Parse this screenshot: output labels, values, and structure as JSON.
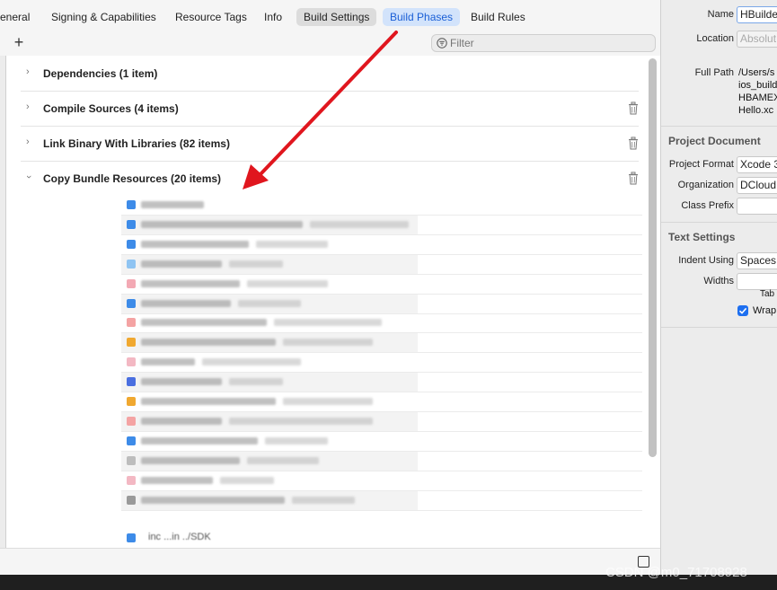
{
  "tabs": [
    {
      "label": "eneral"
    },
    {
      "label": "Signing & Capabilities"
    },
    {
      "label": "Resource Tags"
    },
    {
      "label": "Info"
    },
    {
      "label": "Build Settings"
    },
    {
      "label": "Build Phases"
    },
    {
      "label": "Build Rules"
    }
  ],
  "toolbar": {
    "add_label": "+",
    "filter_placeholder": "Filter"
  },
  "phases": [
    {
      "title": "Dependencies (1 item)"
    },
    {
      "title": "Compile Sources (4 items)"
    },
    {
      "title": "Link Binary With Libraries (82 items)"
    },
    {
      "title": "Copy Bundle Resources (20 items)"
    }
  ],
  "resources": {
    "last_row_text": "inc ...in ../SDK"
  },
  "inspector": {
    "name_label": "Name",
    "name_value": "HBuilde",
    "location_label": "Location",
    "location_value": "Absolut",
    "full_path_label": "Full Path",
    "full_path_lines": [
      "/Users/s",
      "ios_build",
      "HBAMEX",
      "Hello.xc"
    ],
    "project_document_heading": "Project Document",
    "project_format_label": "Project Format",
    "project_format_value": "Xcode 3",
    "organization_label": "Organization",
    "organization_value": "DCloud",
    "class_prefix_label": "Class Prefix",
    "class_prefix_value": "",
    "text_settings_heading": "Text Settings",
    "indent_using_label": "Indent Using",
    "indent_using_value": "Spaces",
    "widths_label": "Widths",
    "tab_label": "Tab",
    "wrap_label": "Wrap"
  },
  "watermark": "CSDN @m0_71708928",
  "colors": {
    "accent": "#1a5fd6",
    "arrow": "#e0161e"
  }
}
